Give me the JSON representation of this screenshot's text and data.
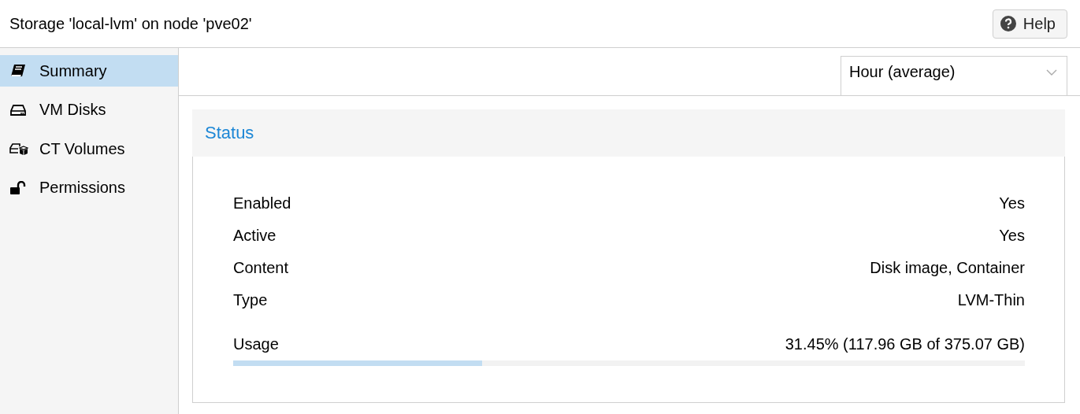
{
  "window": {
    "title": "Storage 'local-lvm' on node 'pve02'"
  },
  "help_button": {
    "label": "Help"
  },
  "sidebar": {
    "items": [
      {
        "label": "Summary",
        "selected": true
      },
      {
        "label": "VM Disks",
        "selected": false
      },
      {
        "label": "CT Volumes",
        "selected": false
      },
      {
        "label": "Permissions",
        "selected": false
      }
    ]
  },
  "timeframe": {
    "value": "Hour (average)"
  },
  "status": {
    "title": "Status",
    "rows": [
      {
        "label": "Enabled",
        "value": "Yes"
      },
      {
        "label": "Active",
        "value": "Yes"
      },
      {
        "label": "Content",
        "value": "Disk image, Container"
      },
      {
        "label": "Type",
        "value": "LVM-Thin"
      }
    ],
    "usage": {
      "label": "Usage",
      "value": "31.45% (117.96 GB of 375.07 GB)",
      "level": 0.3145
    }
  }
}
